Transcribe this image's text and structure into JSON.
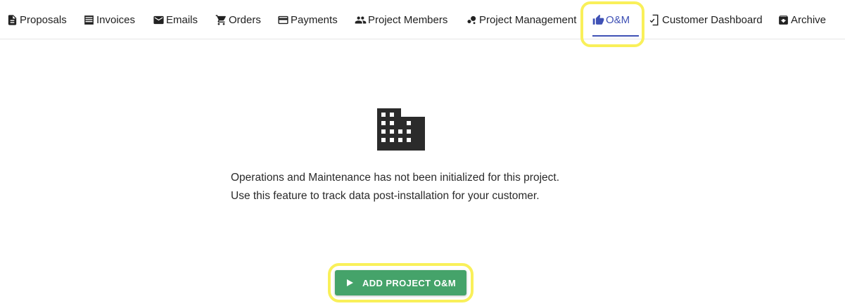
{
  "tabs": [
    {
      "label": "Proposals",
      "icon": "description-icon",
      "active": false
    },
    {
      "label": "Invoices",
      "icon": "invoice-list-icon",
      "active": false
    },
    {
      "label": "Emails",
      "icon": "mail-icon",
      "active": false
    },
    {
      "label": "Orders",
      "icon": "shopping-cart-icon",
      "active": false
    },
    {
      "label": "Payments",
      "icon": "credit-card-icon",
      "active": false
    },
    {
      "label": "Project Members",
      "icon": "people-icon",
      "active": false
    },
    {
      "label": "Project Management",
      "icon": "bubble-chart-icon",
      "active": false
    },
    {
      "label": "O&M",
      "icon": "thumb-up-icon",
      "active": true
    },
    {
      "label": "Customer Dashboard",
      "icon": "phone-check-icon",
      "active": false
    },
    {
      "label": "Archive",
      "icon": "archive-box-icon",
      "active": false
    }
  ],
  "empty_state": {
    "icon": "building-icon",
    "line1": "Operations and Maintenance has not been initialized for this project.",
    "line2": "Use this feature to track data post-installation for your customer."
  },
  "action_button": {
    "label": "ADD PROJECT O&M",
    "icon": "play-icon"
  },
  "colors": {
    "accent": "#3f51b5",
    "button": "#45a36a",
    "highlight": "#f9f05a",
    "icon": "#2b2b2b"
  }
}
